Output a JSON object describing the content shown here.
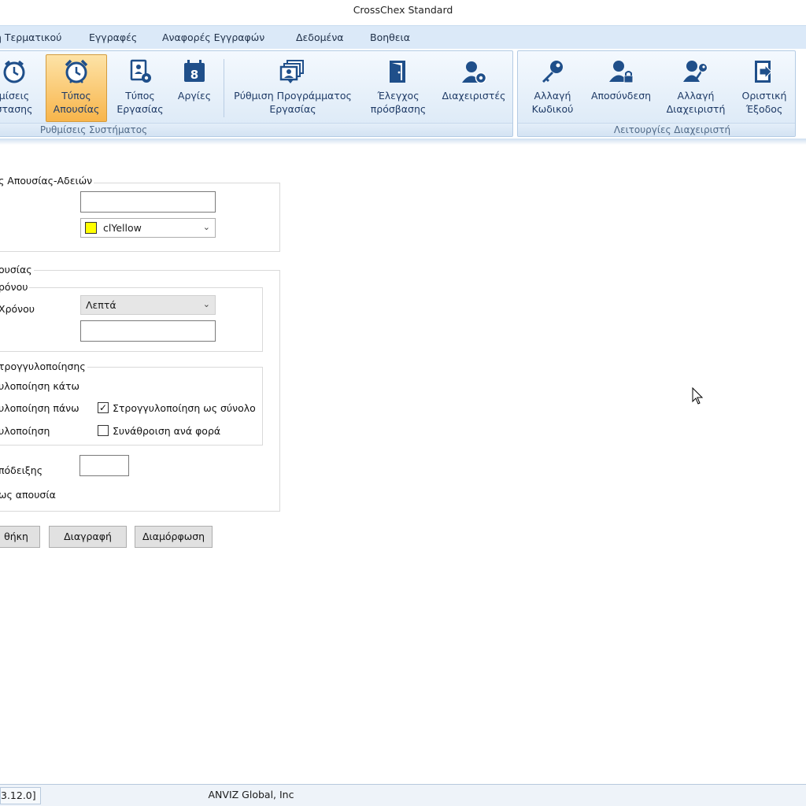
{
  "window": {
    "title": "CrossChex Standard"
  },
  "menu": {
    "items": [
      "η Τερματικού",
      "Εγγραφές",
      "Αναφορές Εγγραφών",
      "Δεδομένα",
      "Βοηθεια"
    ]
  },
  "ribbon": {
    "group1": {
      "caption": "Ρυθμίσεις Συστήματος",
      "buttons": [
        {
          "label1": "μίσεις",
          "label2": "στασης",
          "icon": "clock-icon"
        },
        {
          "label1": "Τύπος",
          "label2": "Απουσίας",
          "icon": "alarm-clock-icon",
          "active": true
        },
        {
          "label1": "Τύπος",
          "label2": "Εργασίας",
          "icon": "worker-settings-icon"
        },
        {
          "label1": "Αργίες",
          "label2": "",
          "icon": "calendar-icon"
        },
        {
          "label1": "Ρύθμιση Προγράμματος",
          "label2": "Εργασίας",
          "icon": "schedule-icon"
        },
        {
          "label1": "Έλεγχος",
          "label2": "πρόσβασης",
          "icon": "door-icon"
        },
        {
          "label1": "Διαχειριστές",
          "label2": "",
          "icon": "admin-gear-icon"
        }
      ]
    },
    "group2": {
      "caption": "Λειτουργίες Διαχειριστή",
      "buttons": [
        {
          "label1": "Αλλαγή",
          "label2": "Κωδικού",
          "icon": "key-icon"
        },
        {
          "label1": "Αποσύνδεση",
          "label2": "",
          "icon": "user-lock-icon"
        },
        {
          "label1": "Αλλαγή",
          "label2": "Διαχειριστή",
          "icon": "user-key-icon"
        },
        {
          "label1": "Οριστική",
          "label2": "Έξοδος",
          "icon": "exit-icon"
        }
      ]
    }
  },
  "form": {
    "section1": {
      "title": "ς Απουσίας-Αδειών",
      "name_value": "",
      "color_value": "clYellow",
      "color_hex": "#ffff00"
    },
    "section2": {
      "title": "ουσίας",
      "time_group": {
        "title": "ρόνου",
        "unit_label": "Χρόνου",
        "unit_value": "Λεπτά",
        "value_label": ":",
        "value": ""
      },
      "rounding_group": {
        "title": "τρογγυλοποίησης",
        "option_down": "υλοποίηση κάτω",
        "option_up": "υλοποίηση πάνω",
        "option_round": "υλοποίηση",
        "check_total_label": "Στρογγυλοποίηση ως σύνολο",
        "check_total_checked": true,
        "check_sum_label": "Συνάθροιση ανά φορά",
        "check_sum_checked": false
      },
      "symbol_label": "πόδειξης",
      "symbol_value": "",
      "absence_label": "ως απουσία"
    },
    "buttons": {
      "add": "θήκη",
      "delete": "Διαγραφή",
      "modify": "Διαμόρφωση"
    }
  },
  "statusbar": {
    "version": "3.12.0]",
    "company": "ANVIZ Global, Inc"
  }
}
